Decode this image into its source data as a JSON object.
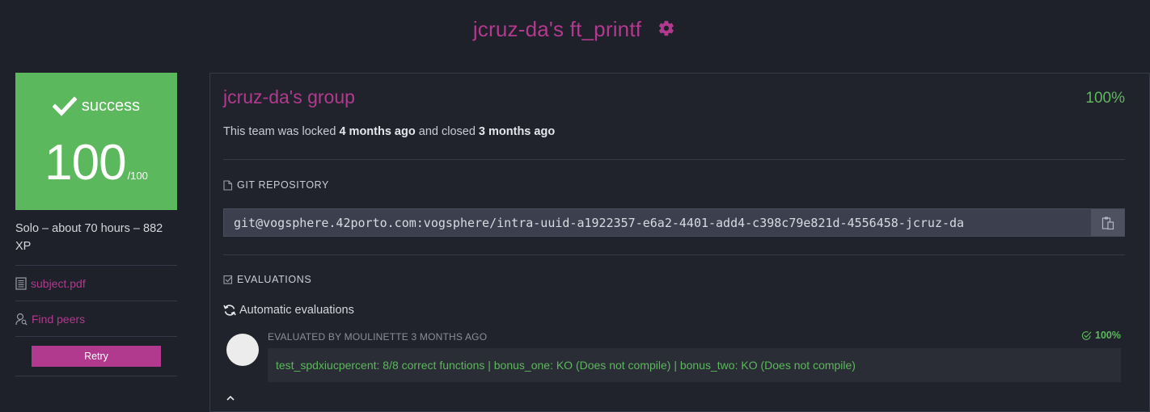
{
  "header": {
    "title": "jcruz-da's ft_printf"
  },
  "sidebar": {
    "status": "success",
    "score": "100",
    "score_max": "/100",
    "project_info": "Solo – about 70 hours – 882 XP",
    "links": {
      "subject": "subject.pdf",
      "find_peers": "Find peers"
    },
    "retry_label": "Retry"
  },
  "main": {
    "group_title": "jcruz-da's group",
    "group_percentage": "100%",
    "team_status": {
      "prefix": "This team was locked",
      "locked": "4 months ago",
      "middle": "and closed",
      "closed": "3 months ago"
    },
    "git_label": "GIT REPOSITORY",
    "repo_url": "git@vogsphere.42porto.com:vogsphere/intra-uuid-a1922357-e6a2-4401-add4-c398c79e821d-4556458-jcruz-da",
    "evaluations_label": "EVALUATIONS",
    "automatic_label": "Automatic evaluations",
    "evaluation": {
      "meta": "EVALUATED BY MOULINETTE 3 MONTHS AGO",
      "score": "100%",
      "result": "test_spdxiucpercent: 8/8 correct functions | bonus_one: KO (Does not compile) | bonus_two: KO (Does not compile)"
    }
  },
  "colors": {
    "brand": "#b23a8e",
    "success": "#5cb85c",
    "background": "#1e202a"
  },
  "icons": [
    "gear-icon",
    "check-icon",
    "document-icon",
    "user-search-icon",
    "file-icon",
    "checkbox-icon",
    "copy-icon",
    "refresh-icon",
    "check-circle-icon"
  ]
}
